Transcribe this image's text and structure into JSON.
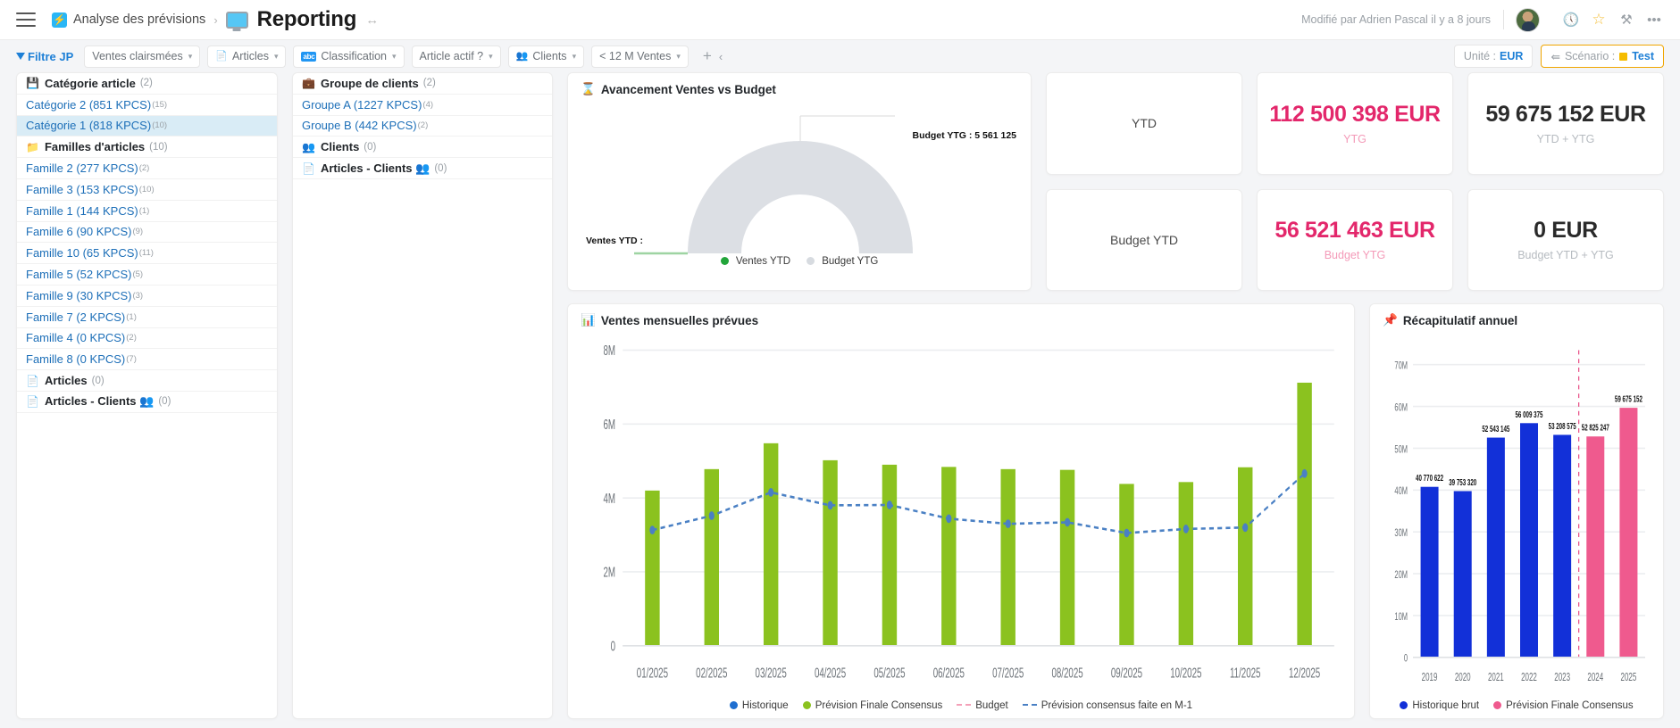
{
  "header": {
    "menu_icon": "hamburger-icon",
    "breadcrumb_app_icon": "bolt-icon",
    "breadcrumb_parent": "Analyse des prévisions",
    "breadcrumb_sep": "›",
    "page_icon": "monitor-icon",
    "title": "Reporting",
    "nav_arrows": "↔",
    "modified_text": "Modifié par Adrien Pascal il y a 8 jours",
    "icons": [
      {
        "name": "history-icon",
        "glyph": "🕔"
      },
      {
        "name": "star-icon",
        "glyph": "☆"
      },
      {
        "name": "tools-icon",
        "glyph": "⚒"
      },
      {
        "name": "more-icon",
        "glyph": "•••"
      }
    ]
  },
  "filter_bar": {
    "label": "Filtre JP",
    "chips": [
      {
        "icon": "",
        "label": "Ventes clairsmées",
        "caret": "▾"
      },
      {
        "icon": "📄",
        "label": "Articles",
        "caret": "▾"
      },
      {
        "icon": "abc",
        "label": "Classification",
        "caret": "▾"
      },
      {
        "icon": "",
        "label": "Article actif ?",
        "caret": "▾"
      },
      {
        "icon": "👥",
        "label": "Clients",
        "caret": "▾"
      },
      {
        "icon": "",
        "label": "< 12 M Ventes",
        "caret": "▾"
      }
    ],
    "add_label": "+",
    "collapse_label": "‹",
    "unit_prefix": "Unité :",
    "unit_value": "EUR",
    "scenario_icon": "share-icon",
    "scenario_prefix": "Scénario :",
    "scenario_value": "Test"
  },
  "tree_left": [
    {
      "type": "head",
      "icon": "💾",
      "label": "Catégorie article",
      "count": "(2)"
    },
    {
      "type": "leaf",
      "label": "Catégorie 2 (851 KPCS)",
      "sup": "(15)",
      "selected": false
    },
    {
      "type": "leaf",
      "label": "Catégorie 1 (818 KPCS)",
      "sup": "(10)",
      "selected": true
    },
    {
      "type": "head",
      "icon": "📁",
      "label": "Familles d'articles",
      "count": "(10)"
    },
    {
      "type": "leaf",
      "label": "Famille 2 (277 KPCS)",
      "sup": "(2)",
      "selected": false
    },
    {
      "type": "leaf",
      "label": "Famille 3 (153 KPCS)",
      "sup": "(10)",
      "selected": false
    },
    {
      "type": "leaf",
      "label": "Famille 1 (144 KPCS)",
      "sup": "(1)",
      "selected": false
    },
    {
      "type": "leaf",
      "label": "Famille 6 (90 KPCS)",
      "sup": "(9)",
      "selected": false
    },
    {
      "type": "leaf",
      "label": "Famille 10 (65 KPCS)",
      "sup": "(11)",
      "selected": false
    },
    {
      "type": "leaf",
      "label": "Famille 5 (52 KPCS)",
      "sup": "(5)",
      "selected": false
    },
    {
      "type": "leaf",
      "label": "Famille 9 (30 KPCS)",
      "sup": "(3)",
      "selected": false
    },
    {
      "type": "leaf",
      "label": "Famille 7 (2 KPCS)",
      "sup": "(1)",
      "selected": false
    },
    {
      "type": "leaf",
      "label": "Famille 4 (0 KPCS)",
      "sup": "(2)",
      "selected": false
    },
    {
      "type": "leaf",
      "label": "Famille 8 (0 KPCS)",
      "sup": "(7)",
      "selected": false
    },
    {
      "type": "head",
      "icon": "📄",
      "label": "Articles",
      "count": "(0)"
    },
    {
      "type": "head",
      "icon": "📄",
      "label": "Articles - Clients 👥",
      "count": "(0)"
    }
  ],
  "tree_right": [
    {
      "type": "head",
      "icon": "💼",
      "label": "Groupe de clients",
      "count": "(2)"
    },
    {
      "type": "leaf",
      "label": "Groupe A (1227 KPCS)",
      "sup": "(4)",
      "selected": false
    },
    {
      "type": "leaf",
      "label": "Groupe B (442 KPCS)",
      "sup": "(2)",
      "selected": false
    },
    {
      "type": "head",
      "icon": "👥",
      "label": "Clients",
      "count": "(0)"
    },
    {
      "type": "head",
      "icon": "📄",
      "label": "Articles - Clients 👥",
      "count": "(0)"
    }
  ],
  "gauge_card": {
    "icon": "⌛",
    "title": "Avancement Ventes vs Budget",
    "left_label": "Ventes YTD :",
    "right_label": "Budget YTG : 5 561 125",
    "legend": [
      {
        "name": "ventes-ytd",
        "label": "Ventes YTD",
        "color": "#22a53a"
      },
      {
        "name": "budget-ytg",
        "label": "Budget YTG",
        "color": "#d7dbe0"
      }
    ]
  },
  "kpis": [
    {
      "name": "ytd-title",
      "kind": "title",
      "value": "YTD",
      "label": ""
    },
    {
      "name": "ytg-value",
      "kind": "pink",
      "value": "112 500 398 EUR",
      "label": "YTG"
    },
    {
      "name": "ytd-ytg-value",
      "kind": "dark",
      "value": "59 675 152 EUR",
      "label": "YTD + YTG"
    },
    {
      "name": "budget-ytd-title",
      "kind": "title",
      "value": "Budget YTD",
      "label": ""
    },
    {
      "name": "budget-ytg-value",
      "kind": "pink",
      "value": "56 521 463 EUR",
      "label": "Budget YTG"
    },
    {
      "name": "budget-ytd-ytg-value",
      "kind": "dark",
      "value": "0 EUR",
      "label": "Budget YTD + YTG"
    }
  ],
  "monthly_card": {
    "icon": "📊",
    "title": "Ventes mensuelles prévues"
  },
  "annual_card": {
    "icon": "📌",
    "title": "Récapitulatif annuel"
  },
  "chart_data": [
    {
      "type": "bar",
      "name": "ventes-mensuelles-prevues",
      "title": "Ventes mensuelles prévues",
      "xlabel": "",
      "ylabel": "",
      "ylim": [
        0,
        8000000
      ],
      "yticks": [
        0,
        2000000,
        4000000,
        6000000,
        8000000
      ],
      "ytick_labels": [
        "0",
        "2M",
        "4M",
        "6M",
        "8M"
      ],
      "grid": true,
      "legend_position": "bottom",
      "categories": [
        "01/2025",
        "02/2025",
        "03/2025",
        "04/2025",
        "05/2025",
        "06/2025",
        "07/2025",
        "08/2025",
        "09/2025",
        "10/2025",
        "11/2025",
        "12/2025"
      ],
      "series": [
        {
          "name": "Historique",
          "type": "bar",
          "color": "#1f6fd0",
          "values": [
            null,
            null,
            null,
            null,
            null,
            null,
            null,
            null,
            null,
            null,
            null,
            null
          ]
        },
        {
          "name": "Prévision Finale Consensus",
          "type": "bar",
          "color": "#8bc21f",
          "values": [
            4200000,
            4780000,
            5480000,
            5020000,
            4900000,
            4840000,
            4780000,
            4760000,
            4380000,
            4430000,
            4830000,
            7120000
          ]
        },
        {
          "name": "Budget",
          "type": "line",
          "color": "#f4a0b8",
          "values": [
            null,
            null,
            null,
            null,
            null,
            null,
            null,
            null,
            null,
            null,
            null,
            null
          ]
        },
        {
          "name": "Prévision consensus faite en M-1",
          "type": "line",
          "color": "#4a80c4",
          "values": [
            3130000,
            3520000,
            4150000,
            3800000,
            3810000,
            3440000,
            3300000,
            3340000,
            3050000,
            3160000,
            3200000,
            4660000
          ]
        }
      ],
      "legend": [
        {
          "label": "Historique",
          "color": "#1f6fd0",
          "marker": "dot"
        },
        {
          "label": "Prévision Finale Consensus",
          "color": "#8bc21f",
          "marker": "dot"
        },
        {
          "label": "Budget",
          "color": "#f4a0b8",
          "marker": "dashed"
        },
        {
          "label": "Prévision consensus faite en M-1",
          "color": "#4a80c4",
          "marker": "dashed"
        }
      ]
    },
    {
      "type": "bar",
      "name": "recapitulatif-annuel",
      "title": "Récapitulatif annuel",
      "xlabel": "",
      "ylabel": "",
      "ylim": [
        0,
        70000000
      ],
      "yticks": [
        0,
        10000000,
        20000000,
        30000000,
        40000000,
        50000000,
        60000000,
        70000000
      ],
      "ytick_labels": [
        "0",
        "10M",
        "20M",
        "30M",
        "40M",
        "50M",
        "60M",
        "70M"
      ],
      "grid": true,
      "legend_position": "bottom",
      "categories": [
        "2019",
        "2020",
        "2021",
        "2022",
        "2023",
        "2024",
        "2025"
      ],
      "bar_labels": [
        "40 770 622",
        "39 753 320",
        "52 543 145",
        "56 009 375",
        "53 208 575",
        "52 825 247",
        "59 675 152"
      ],
      "values": [
        40770622,
        39753320,
        52543145,
        56009375,
        53208575,
        52825247,
        59675152
      ],
      "colors": [
        "#1230d8",
        "#1230d8",
        "#1230d8",
        "#1230d8",
        "#1230d8",
        "#ef5a8e",
        "#ef5a8e"
      ],
      "divider_after": "2023",
      "divider_color": "#e3276b",
      "legend": [
        {
          "label": "Historique brut",
          "color": "#1230d8"
        },
        {
          "label": "Prévision Finale Consensus",
          "color": "#ef5a8e"
        }
      ]
    },
    {
      "type": "pie",
      "name": "avancement-ventes-vs-budget",
      "title": "Avancement Ventes vs Budget",
      "labels": [
        "Ventes YTD",
        "Budget YTG"
      ],
      "colors": [
        "#22a53a",
        "#d7dbe0"
      ],
      "values": [
        0,
        5561125
      ],
      "annotations": [
        "Ventes YTD :",
        "Budget YTG : 5 561 125"
      ]
    }
  ]
}
